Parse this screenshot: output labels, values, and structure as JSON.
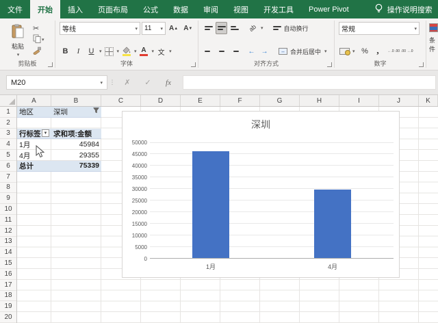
{
  "app": {
    "tabs": [
      {
        "label": "文件",
        "active": false
      },
      {
        "label": "开始",
        "active": true
      },
      {
        "label": "插入",
        "active": false
      },
      {
        "label": "页面布局",
        "active": false
      },
      {
        "label": "公式",
        "active": false
      },
      {
        "label": "数据",
        "active": false
      },
      {
        "label": "审阅",
        "active": false
      },
      {
        "label": "视图",
        "active": false
      },
      {
        "label": "开发工具",
        "active": false
      },
      {
        "label": "Power Pivot",
        "active": false
      }
    ],
    "tell_me": "操作说明搜索"
  },
  "ribbon": {
    "clipboard": {
      "group_label": "剪贴板",
      "paste_label": "粘贴"
    },
    "font": {
      "group_label": "字体",
      "font_name": "等线",
      "font_size": "11"
    },
    "alignment": {
      "group_label": "对齐方式",
      "wrap_text": "自动换行",
      "merge_center": "合并后居中"
    },
    "number": {
      "group_label": "数字",
      "format": "常规"
    },
    "conditional": {
      "label": "条件"
    }
  },
  "formula_bar": {
    "name_box": "M20"
  },
  "sheet": {
    "columns": [
      "A",
      "B",
      "C",
      "D",
      "E",
      "F",
      "G",
      "H",
      "I",
      "J",
      "K"
    ],
    "row_count": 20
  },
  "pivot": {
    "filter_field": "地区",
    "filter_value": "深圳",
    "row_header": "行标签",
    "value_header": "求和项:金额",
    "rows": [
      [
        "1月",
        "45984"
      ],
      [
        "4月",
        "29355"
      ]
    ],
    "total_label": "总计",
    "total_value": "75339"
  },
  "chart_data": {
    "type": "bar",
    "title": "深圳",
    "categories": [
      "1月",
      "4月"
    ],
    "values": [
      45984,
      29355
    ],
    "xlabel": "",
    "ylabel": "",
    "ylim": [
      0,
      50000
    ],
    "ytick_step": 5000,
    "grid": true,
    "legend": "none",
    "bar_color": "#4472C4"
  },
  "icons": {
    "dropdown": "▾",
    "dropdown_small": "▼",
    "scissors": "✂",
    "cancel": "✗",
    "check": "✓",
    "fx": "fx",
    "bold": "B",
    "italic": "I",
    "underline": "U",
    "phonetic": "文",
    "grow_font": "A",
    "shrink_font": "A",
    "font_color_letter": "A",
    "percent": "%",
    "comma": ",",
    "orientation": "ab",
    "wrap_return": "↩",
    "merge_arrows": "↔",
    "indent_left": "←",
    "indent_right": "→",
    "increase_decimal": "←.0 .00",
    "decrease_decimal": ".00 →.0",
    "vertical_dots": "⋮"
  },
  "colors": {
    "excel_green": "#217346",
    "pivot_fill": "#DCE6F1",
    "bar_blue": "#4472C4",
    "fill_color_swatch": "#F7E244",
    "font_color_swatch": "#E03C31"
  }
}
